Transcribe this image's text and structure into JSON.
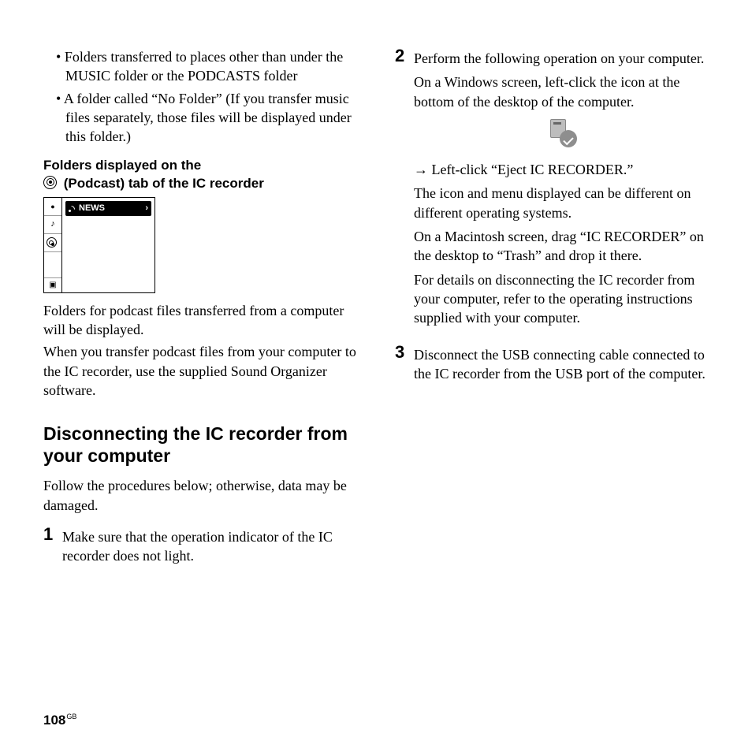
{
  "left": {
    "bullets": [
      "Folders transferred to places other than under the MUSIC folder or the PODCASTS folder",
      "A folder called “No Folder” (If you transfer music files separately, those files will be displayed under this folder.)"
    ],
    "subheading_line1": "Folders displayed on the",
    "subheading_line2": " (Podcast) tab of the IC recorder",
    "device_news_label": "NEWS",
    "device_news_arrow": "›",
    "tab_mic": "⬤",
    "tab_music": "♪",
    "tab_podcast": "◎",
    "tab_rec": "▣",
    "p1": "Folders for podcast files transferred from a computer will be displayed.",
    "p2": "When you transfer podcast files from your computer to the IC recorder, use the supplied Sound Organizer software.",
    "heading": "Disconnecting the IC recorder from your computer",
    "intro": "Follow the procedures below; otherwise, data may be damaged.",
    "step1_num": "1",
    "step1": "Make sure that the operation indicator of the IC recorder does not light."
  },
  "right": {
    "step2_num": "2",
    "step2_a": "Perform the following operation on your computer.",
    "step2_b": "On a Windows screen, left-click the icon at the bottom of the desktop of the computer.",
    "step2_c_arrow": "→",
    "step2_c": " Left-click “Eject IC RECORDER.”",
    "step2_d": "The icon and menu displayed can be different on different operating systems.",
    "step2_e": "On a Macintosh screen, drag “IC RECORDER” on the desktop to “Trash” and drop it there.",
    "step2_f": "For details on disconnecting the IC recorder from your computer, refer to the operating instructions supplied with your computer.",
    "step3_num": "3",
    "step3": "Disconnect the USB connecting cable connected to the IC recorder from the USB port of the computer."
  },
  "footer": {
    "page": "108",
    "region": "GB"
  }
}
